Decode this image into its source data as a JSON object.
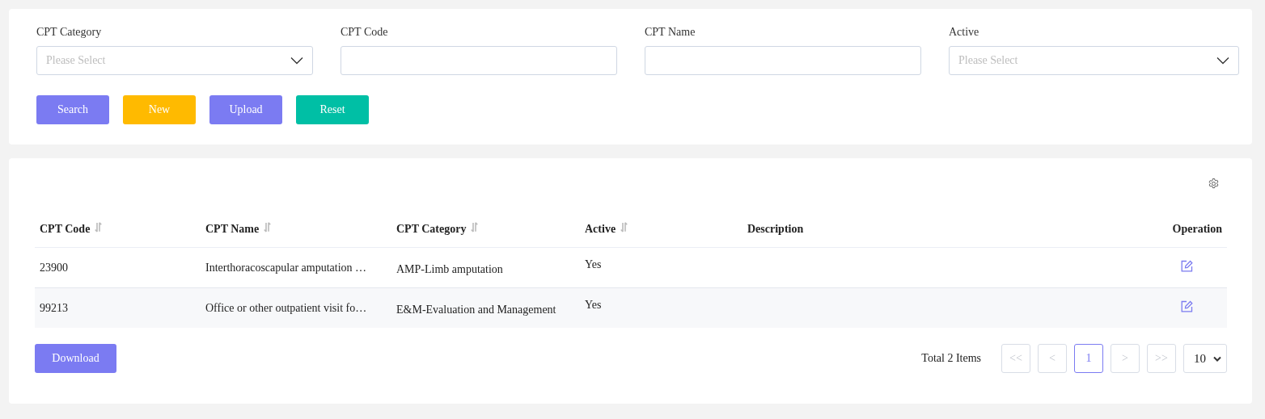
{
  "filters": [
    {
      "label": "CPT Category",
      "kind": "select",
      "placeholder": "Please Select"
    },
    {
      "label": "CPT Code",
      "kind": "text"
    },
    {
      "label": "CPT Name",
      "kind": "text"
    },
    {
      "label": "Active",
      "kind": "select",
      "placeholder": "Please Select"
    }
  ],
  "actions": [
    {
      "label": "Search",
      "kind": "primary"
    },
    {
      "label": "New",
      "kind": "warning"
    },
    {
      "label": "Upload",
      "kind": "primary"
    },
    {
      "label": "Reset",
      "kind": "success"
    }
  ],
  "table": {
    "columns": [
      {
        "label": "CPT Code",
        "kind": "sortable"
      },
      {
        "label": "CPT Name",
        "kind": "sortable"
      },
      {
        "label": "CPT Category",
        "kind": "sortable"
      },
      {
        "label": "Active",
        "kind": "sortable"
      },
      {
        "label": "Description",
        "kind": "plain"
      },
      {
        "label": "Operation",
        "kind": "plain"
      }
    ],
    "rows": [
      {
        "code": "23900",
        "name": "Interthoracoscapular amputation …",
        "category": "AMP-Limb amputation",
        "active": "Yes"
      },
      {
        "code": "99213",
        "name": "Office or other outpatient visit fo…",
        "category": "E&M-Evaluation and Management",
        "active": "Yes"
      }
    ]
  },
  "download": "Download",
  "pagination": {
    "total": "Total 2 Items",
    "pages": [
      {
        "label": "<<",
        "selected": false
      },
      {
        "label": "<",
        "selected": false
      },
      {
        "label": "1",
        "selected": true
      },
      {
        "label": ">",
        "selected": false
      },
      {
        "label": ">>",
        "selected": false
      }
    ],
    "page_size": "10"
  }
}
